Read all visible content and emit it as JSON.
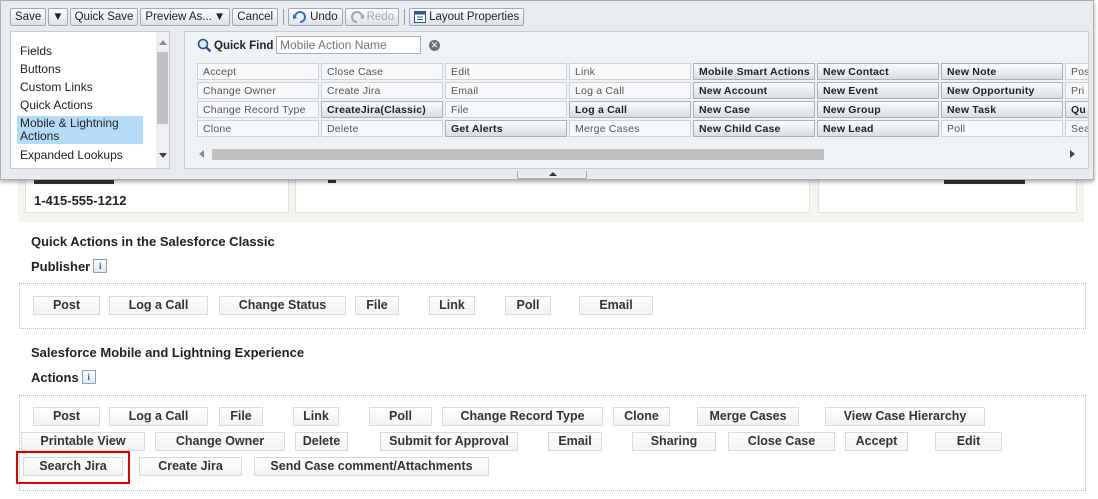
{
  "toolbar": {
    "save": "Save",
    "quick_save": "Quick Save",
    "preview_as": "Preview As...",
    "cancel": "Cancel",
    "undo": "Undo",
    "redo": "Redo",
    "layout_properties": "Layout Properties"
  },
  "palette": {
    "categories": [
      "Fields",
      "Buttons",
      "Custom Links",
      "Quick Actions",
      "Mobile & Lightning Actions",
      "Expanded Lookups"
    ],
    "selected_category": "Mobile & Lightning Actions",
    "quick_find": {
      "label": "Quick Find",
      "placeholder": "Mobile Action Name"
    },
    "items": [
      [
        "Accept",
        "Close Case",
        "Edit",
        "Link",
        "Mobile Smart Actions",
        "New Contact",
        "New Note",
        "Pos"
      ],
      [
        "Change Owner",
        "Create Jira",
        "Email",
        "Log a Call",
        "New Account",
        "New Event",
        "New Opportunity",
        "Pri"
      ],
      [
        "Change Record Type",
        "CreateJira(Classic)",
        "File",
        "Log a Call",
        "New Case",
        "New Group",
        "New Task",
        "Qu"
      ],
      [
        "Clone",
        "Delete",
        "Get Alerts",
        "Merge Cases",
        "New Child Case",
        "New Lead",
        "Poll",
        "Sea"
      ]
    ]
  },
  "highlights": {
    "phone": "1-415-555-1212"
  },
  "classic_publisher": {
    "title_line1": "Quick Actions in the Salesforce Classic",
    "title_line2": "Publisher",
    "info": "i",
    "actions": [
      "Post",
      "Log a Call",
      "Change Status",
      "File",
      "Link",
      "Poll",
      "Email"
    ]
  },
  "mobile_actions": {
    "title_line1": "Salesforce Mobile and Lightning Experience",
    "title_line2": "Actions",
    "info": "i",
    "actions": [
      "Post",
      "Log a Call",
      "File",
      "Link",
      "Poll",
      "Change Record Type",
      "Clone",
      "Merge Cases",
      "View Case Hierarchy",
      "Printable View",
      "Change Owner",
      "Delete",
      "Submit for Approval",
      "Email",
      "Sharing",
      "Close Case",
      "Accept",
      "Edit",
      "Search Jira",
      "Create Jira",
      "Send Case comment/Attachments"
    ]
  },
  "colors": {
    "highlight_box": "#e00000",
    "selected_category": "#b4dbf7"
  }
}
